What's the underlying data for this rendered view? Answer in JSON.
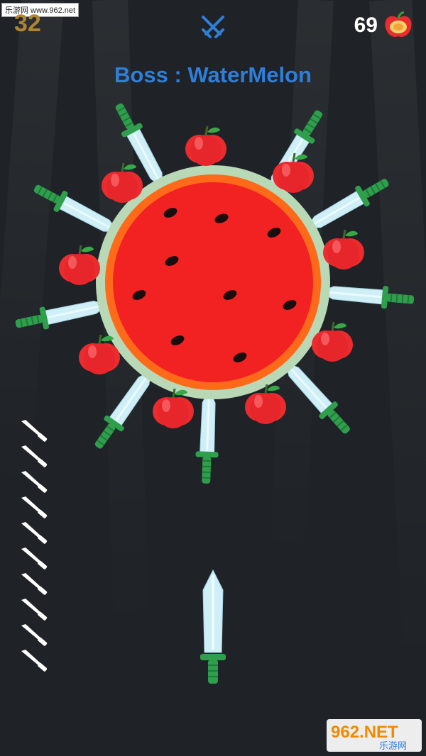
{
  "hud": {
    "stage_score": "32",
    "apple_count": "69",
    "boss_icon": "crossed-swords-icon",
    "apple_icon": "apple-icon"
  },
  "boss": {
    "label": "Boss : WaterMelon",
    "target": "watermelon"
  },
  "stuck_knives": 10,
  "apples_on_target": 10,
  "remaining_knives": 10,
  "watermark": {
    "source": "乐游网 www.962.net",
    "logo": "962.NET",
    "logo_sub": "乐游网"
  },
  "colors": {
    "background": "#1f2327",
    "score": "#b08433",
    "boss_title": "#2f7ed8",
    "watermelon_flesh": "#f22222",
    "watermelon_rind": "#b9d8b6",
    "blade": "#cfeef6",
    "handle": "#2f9e4d",
    "apple": "#ec2b2e"
  }
}
